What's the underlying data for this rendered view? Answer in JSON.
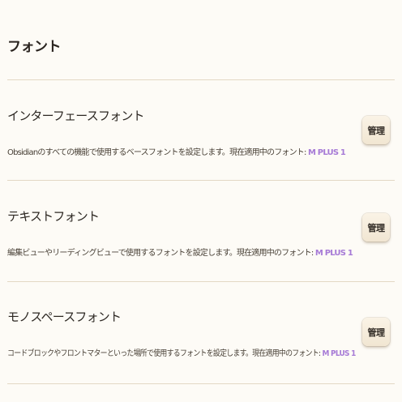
{
  "section": {
    "title": "フォント"
  },
  "settings": [
    {
      "name": "インターフェースフォント",
      "description": "Obsidianのすべての機能で使用するベースフォントを設定します。現在適用中のフォント: ",
      "current_font": "M PLUS 1",
      "button_label": "管理"
    },
    {
      "name": "テキストフォント",
      "description": "編集ビューやリーディングビューで使用するフォントを設定します。現在適用中のフォント: ",
      "current_font": "M PLUS 1",
      "button_label": "管理"
    },
    {
      "name": "モノスペースフォント",
      "description": "コードブロックやフロントマターといった場所で使用するフォントを設定します。現在適用中のフォント: ",
      "current_font": "M PLUS 1",
      "button_label": "管理"
    }
  ],
  "colors": {
    "background": "#fdfbf6",
    "divider": "#e3d8c4",
    "accent": "#a67ad6",
    "button": "#f4ebda"
  }
}
